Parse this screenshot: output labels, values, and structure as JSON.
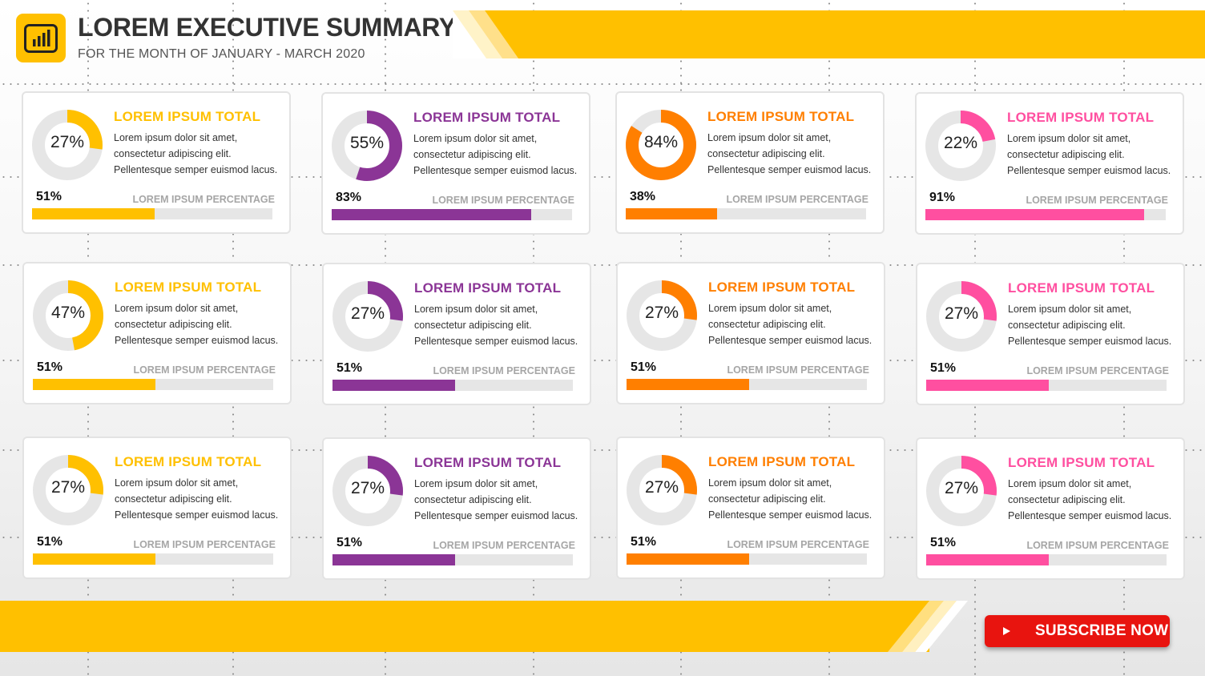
{
  "header": {
    "title": "LOREM EXECUTIVE SUMMARY",
    "subtitle": "FOR THE MONTH OF JANUARY - MARCH 2020",
    "logo_icon": "bar-chart-icon"
  },
  "colors": {
    "accent": "#ffc000",
    "purple": "#8b3596",
    "orange": "#ff7f00",
    "pink": "#ff4fa0",
    "track": "#e6e6e6"
  },
  "cards": [
    {
      "title": "LOREM IPSUM TOTAL",
      "donut": 27,
      "donut_label": "27%",
      "color": "#ffc000",
      "desc": [
        "Lorem ipsum dolor sit amet,",
        "consectetur adipiscing elit.",
        "Pellentesque semper euismod lacus."
      ],
      "pct": 51,
      "pct_label": "51%",
      "bar_caption": "LOREM IPSUM PERCENTAGE"
    },
    {
      "title": "LOREM IPSUM TOTAL",
      "donut": 55,
      "donut_label": "55%",
      "color": "#8b3596",
      "desc": [
        "Lorem ipsum dolor sit amet,",
        "consectetur adipiscing elit.",
        "Pellentesque semper euismod lacus."
      ],
      "pct": 83,
      "pct_label": "83%",
      "bar_caption": "LOREM IPSUM PERCENTAGE"
    },
    {
      "title": "LOREM IPSUM TOTAL",
      "donut": 84,
      "donut_label": "84%",
      "color": "#ff7f00",
      "desc": [
        "Lorem ipsum dolor sit amet,",
        "consectetur adipiscing elit.",
        "Pellentesque semper euismod lacus."
      ],
      "pct": 38,
      "pct_label": "38%",
      "bar_caption": "LOREM IPSUM PERCENTAGE"
    },
    {
      "title": "LOREM IPSUM TOTAL",
      "donut": 22,
      "donut_label": "22%",
      "color": "#ff4fa0",
      "desc": [
        "Lorem ipsum dolor sit amet,",
        "consectetur adipiscing elit.",
        "Pellentesque semper euismod lacus."
      ],
      "pct": 91,
      "pct_label": "91%",
      "bar_caption": "LOREM IPSUM PERCENTAGE"
    },
    {
      "title": "LOREM IPSUM TOTAL",
      "donut": 47,
      "donut_label": "47%",
      "color": "#ffc000",
      "desc": [
        "Lorem ipsum dolor sit amet,",
        "consectetur adipiscing elit.",
        "Pellentesque semper euismod lacus."
      ],
      "pct": 51,
      "pct_label": "51%",
      "bar_caption": "LOREM IPSUM PERCENTAGE"
    },
    {
      "title": "LOREM IPSUM TOTAL",
      "donut": 27,
      "donut_label": "27%",
      "color": "#8b3596",
      "desc": [
        "Lorem ipsum dolor sit amet,",
        "consectetur adipiscing elit.",
        "Pellentesque semper euismod lacus."
      ],
      "pct": 51,
      "pct_label": "51%",
      "bar_caption": "LOREM IPSUM PERCENTAGE"
    },
    {
      "title": "LOREM IPSUM TOTAL",
      "donut": 27,
      "donut_label": "27%",
      "color": "#ff7f00",
      "desc": [
        "Lorem ipsum dolor sit amet,",
        "consectetur adipiscing elit.",
        "Pellentesque semper euismod lacus."
      ],
      "pct": 51,
      "pct_label": "51%",
      "bar_caption": "LOREM IPSUM PERCENTAGE"
    },
    {
      "title": "LOREM IPSUM TOTAL",
      "donut": 27,
      "donut_label": "27%",
      "color": "#ff4fa0",
      "desc": [
        "Lorem ipsum dolor sit amet,",
        "consectetur adipiscing elit.",
        "Pellentesque semper euismod lacus."
      ],
      "pct": 51,
      "pct_label": "51%",
      "bar_caption": "LOREM IPSUM PERCENTAGE"
    },
    {
      "title": "LOREM IPSUM TOTAL",
      "donut": 27,
      "donut_label": "27%",
      "color": "#ffc000",
      "desc": [
        "Lorem ipsum dolor sit amet,",
        "consectetur adipiscing elit.",
        "Pellentesque semper euismod lacus."
      ],
      "pct": 51,
      "pct_label": "51%",
      "bar_caption": "LOREM IPSUM PERCENTAGE"
    },
    {
      "title": "LOREM IPSUM TOTAL",
      "donut": 27,
      "donut_label": "27%",
      "color": "#8b3596",
      "desc": [
        "Lorem ipsum dolor sit amet,",
        "consectetur adipiscing elit.",
        "Pellentesque semper euismod lacus."
      ],
      "pct": 51,
      "pct_label": "51%",
      "bar_caption": "LOREM IPSUM PERCENTAGE"
    },
    {
      "title": "LOREM IPSUM TOTAL",
      "donut": 27,
      "donut_label": "27%",
      "color": "#ff7f00",
      "desc": [
        "Lorem ipsum dolor sit amet,",
        "consectetur adipiscing elit.",
        "Pellentesque semper euismod lacus."
      ],
      "pct": 51,
      "pct_label": "51%",
      "bar_caption": "LOREM IPSUM PERCENTAGE"
    },
    {
      "title": "LOREM IPSUM TOTAL",
      "donut": 27,
      "donut_label": "27%",
      "color": "#ff4fa0",
      "desc": [
        "Lorem ipsum dolor sit amet,",
        "consectetur adipiscing elit.",
        "Pellentesque semper euismod lacus."
      ],
      "pct": 51,
      "pct_label": "51%",
      "bar_caption": "LOREM IPSUM PERCENTAGE"
    }
  ],
  "subscribe": {
    "label": "SUBSCRIBE NOW",
    "icon": "youtube-play-icon"
  }
}
